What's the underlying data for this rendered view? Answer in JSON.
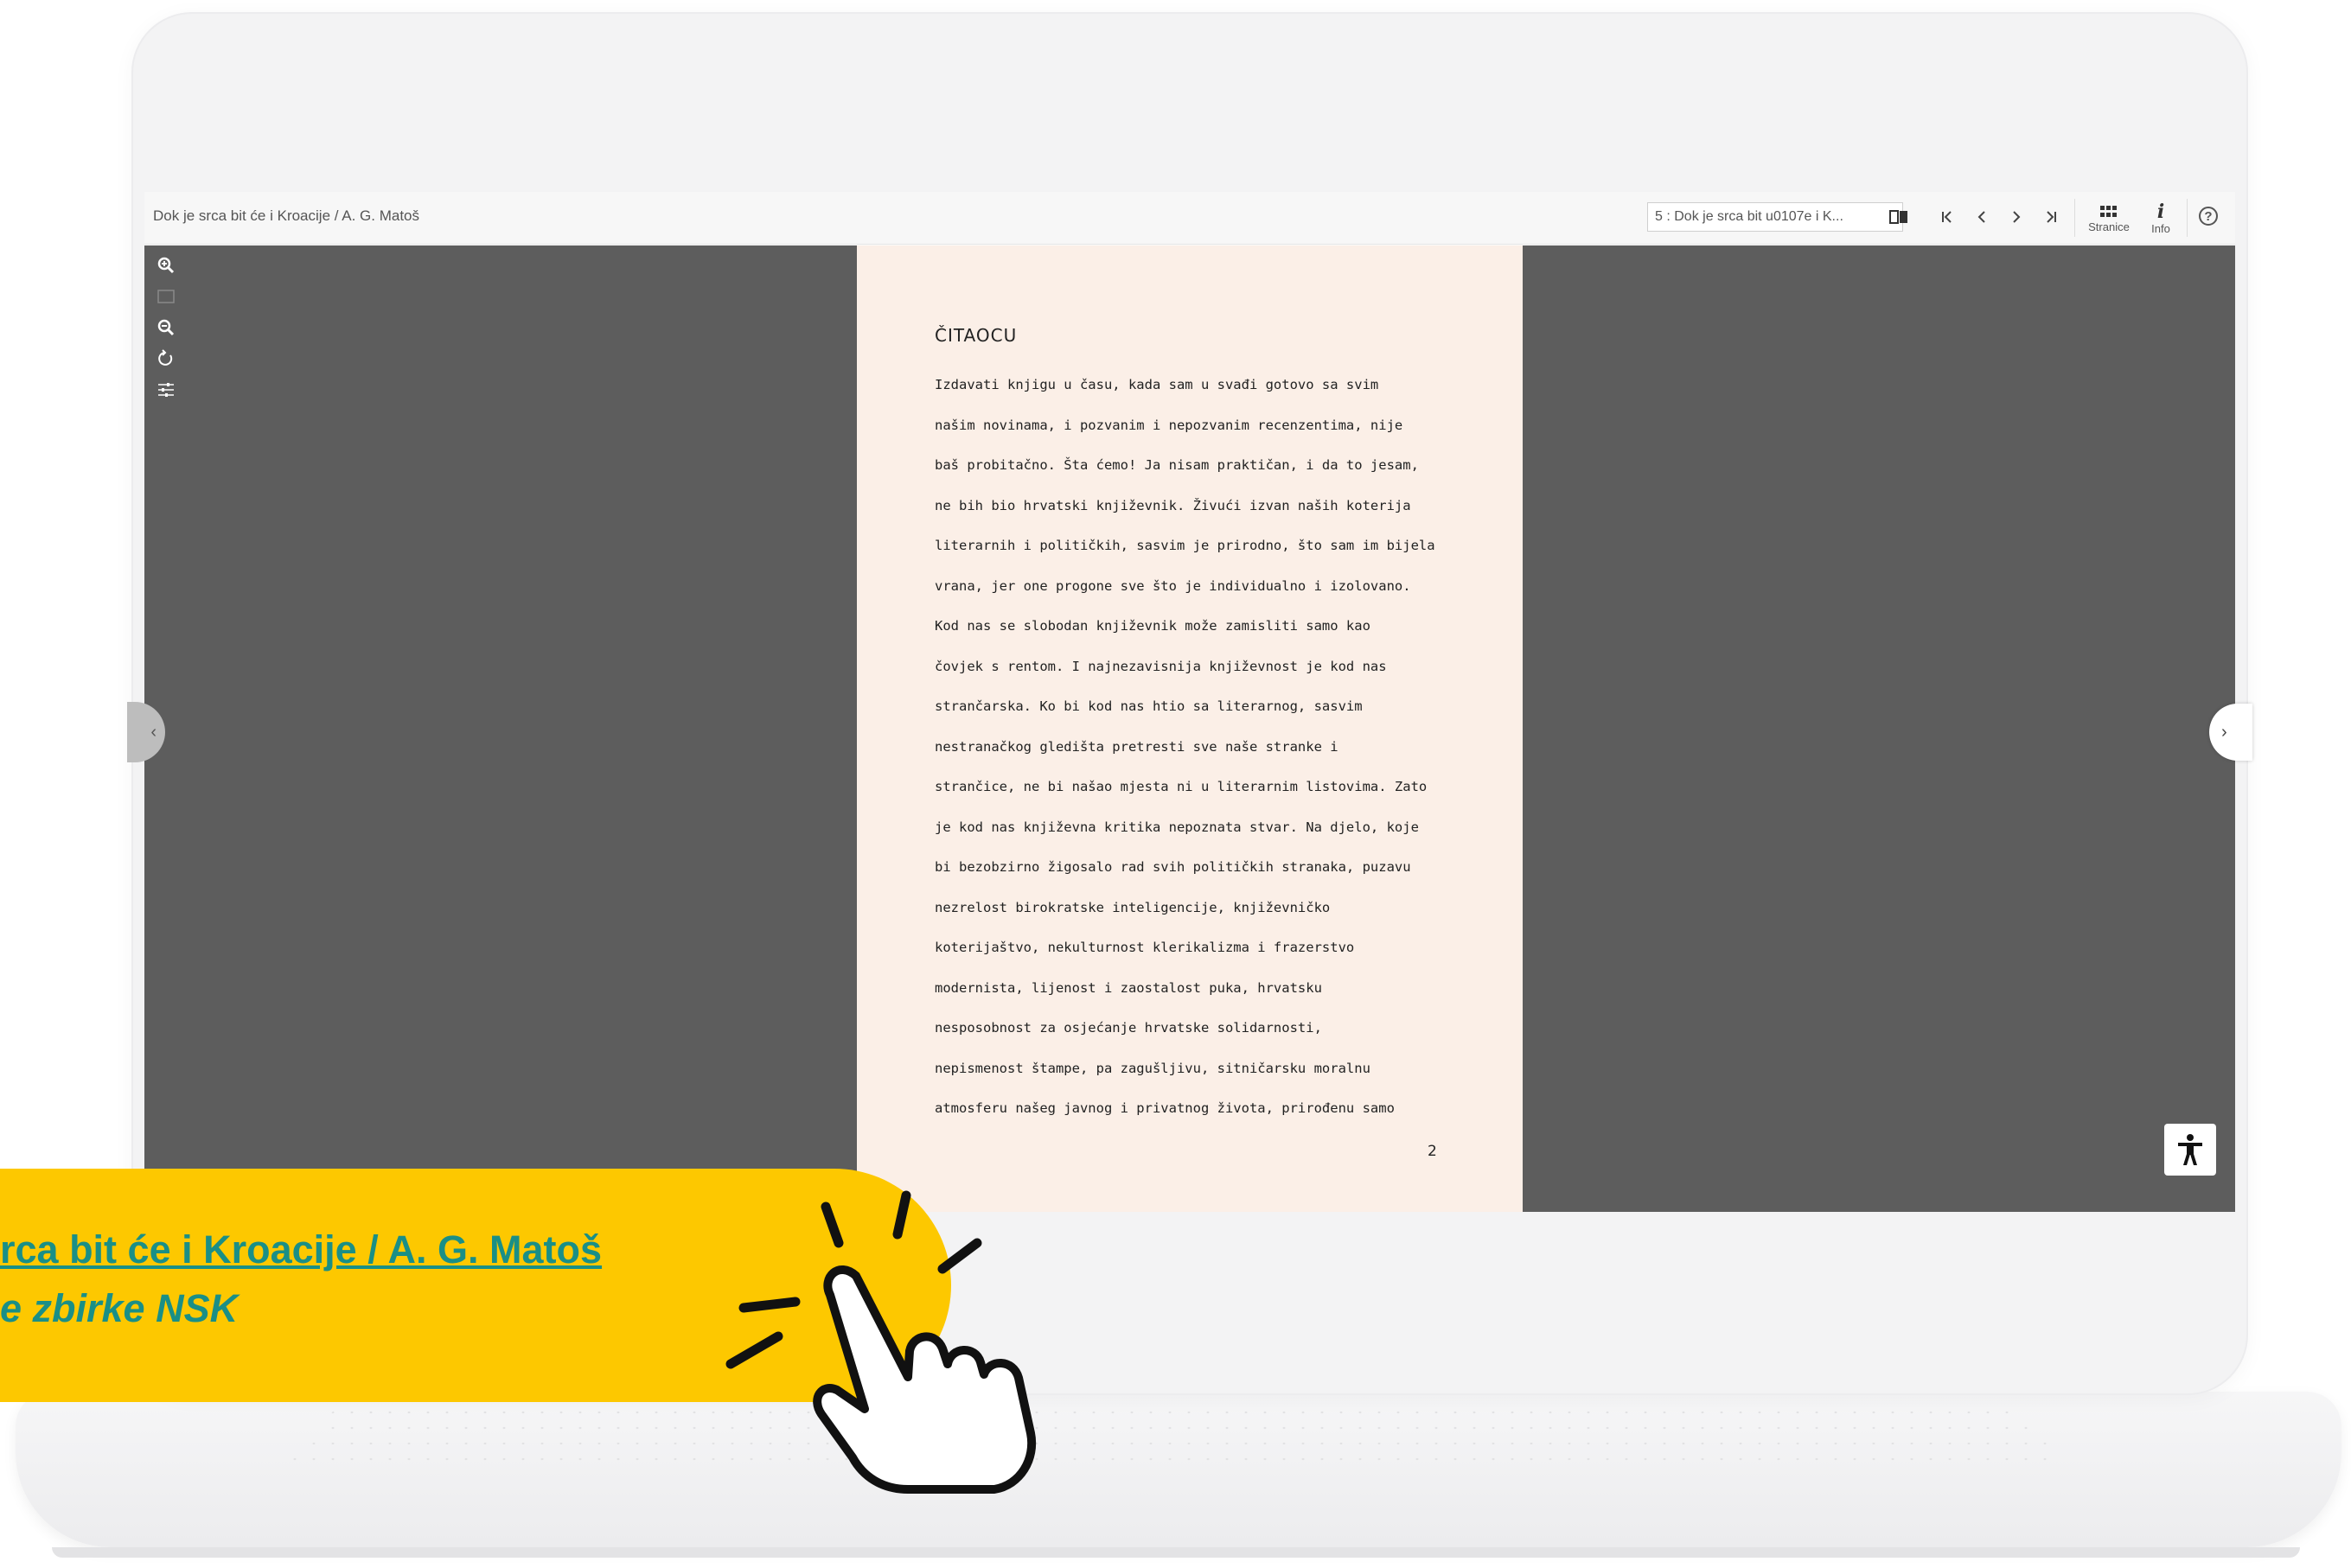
{
  "viewer": {
    "doc_title": "Dok je srca bit će i Kroacije / A. G. Matoš",
    "page_select_value": "5 : Dok je srca bit u0107e i K...",
    "pages_label": "Stranice",
    "info_label": "Info",
    "icons": {
      "book": "book-icon",
      "first": "first-page-icon",
      "prev": "prev-page-icon",
      "next": "next-page-icon",
      "last": "last-page-icon",
      "pages": "grid-icon",
      "info": "info-icon",
      "help": "help-icon",
      "zoom_in": "zoom-in-icon",
      "fit": "fit-page-icon",
      "zoom_out": "zoom-out-icon",
      "rotate": "rotate-icon",
      "adjust": "adjust-icon",
      "accessibility": "accessibility-icon"
    },
    "nav_left": "‹",
    "nav_right": "›"
  },
  "page": {
    "heading": "ČITAOCU",
    "lines": [
      "Izdavati knjigu u času, kada sam u svađi gotovo sa svim",
      "našim novinama, i pozvanim i nepozvanim recenzentima, nije",
      "baš probitačno. Šta ćemo! Ja nisam praktičan, i da to jesam,",
      "ne bih bio hrvatski književnik. Živući izvan naših koterija",
      "literarnih i političkih, sasvim je prirodno, što sam im bijela",
      "vrana, jer one progone sve što je individualno i izolovano.",
      "Kod nas se slobodan književnik može zamisliti samo kao",
      "čovjek s rentom. I najnezavisnija književnost je kod nas",
      "strančarska. Ko bi kod nas htio sa literarnog, sasvim",
      "nestranačkog gledišta pretresti sve naše stranke i",
      "strančice, ne bi našao mjesta ni u literarnim listovima. Zato",
      "je kod nas književna kritika nepoznata stvar. Na djelo, koje",
      "bi bezobzirno žigosalo rad svih političkih stranaka, puzavu",
      "nezrelost birokratske inteligencije, književničko",
      "koterijaštvo, nekulturnost klerikalizma i frazerstvo",
      "modernista, lijenost i zaostalost puka, hrvatsku",
      "nesposobnost za osjećanje hrvatske solidarnosti,",
      "nepismenost štampe, pa zagušljivu, sitničarsku moralnu",
      "atmosferu našeg javnog i privatnog života, prirođenu samo"
    ],
    "page_number": "2"
  },
  "callout": {
    "link_text": "rca bit će i Kroacije / A. G. Matoš",
    "subtitle": "e zbirke NSK",
    "colors": {
      "background": "#fdc800",
      "text": "#1a8f86"
    }
  }
}
